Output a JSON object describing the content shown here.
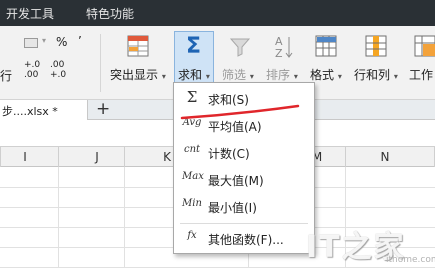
{
  "menubar": {
    "items": [
      "开发工具",
      "特色功能"
    ]
  },
  "ribbon": {
    "left_row1": [
      "%",
      "’"
    ],
    "left_row2": [
      "+.0",
      ".00"
    ],
    "left_row3": [
      ".00",
      "+.0"
    ],
    "left_cut_label": "行",
    "buttons": [
      {
        "label": "突出显示",
        "icon": "highlight-grid-icon"
      },
      {
        "label": "求和",
        "icon": "sigma-icon"
      },
      {
        "label": "筛选",
        "icon": "filter-funnel-icon"
      },
      {
        "label": "排序",
        "icon": "sort-az-icon"
      },
      {
        "label": "格式",
        "icon": "format-table-icon"
      },
      {
        "label": "行和列",
        "icon": "rows-columns-icon"
      },
      {
        "label": "工作",
        "icon": "worksheet-icon"
      }
    ]
  },
  "tabs": {
    "doc_tab": "步....xlsx *",
    "new_tab": "+"
  },
  "columns": [
    "I",
    "J",
    "K",
    "M",
    "N"
  ],
  "dropdown": {
    "items": [
      {
        "icon": "Σ",
        "icon_name": "sigma-icon",
        "label": "求和(S)"
      },
      {
        "icon": "Avg",
        "icon_name": "average-icon",
        "label": "平均值(A)"
      },
      {
        "icon": "cnt",
        "icon_name": "count-icon",
        "label": "计数(C)"
      },
      {
        "icon": "Max",
        "icon_name": "max-icon",
        "label": "最大值(M)"
      },
      {
        "icon": "Min",
        "icon_name": "min-icon",
        "label": "最小值(I)"
      },
      {
        "icon": "fx",
        "icon_name": "function-icon",
        "label": "其他函数(F)..."
      }
    ]
  },
  "watermark": {
    "text": "IT之家",
    "sub": "ithome.com"
  },
  "colors": {
    "menubar": "#2a3035",
    "accent_blue": "#1e64b4",
    "annotation_red": "#e0262b",
    "pressed_bg": "#cfe3f6"
  }
}
